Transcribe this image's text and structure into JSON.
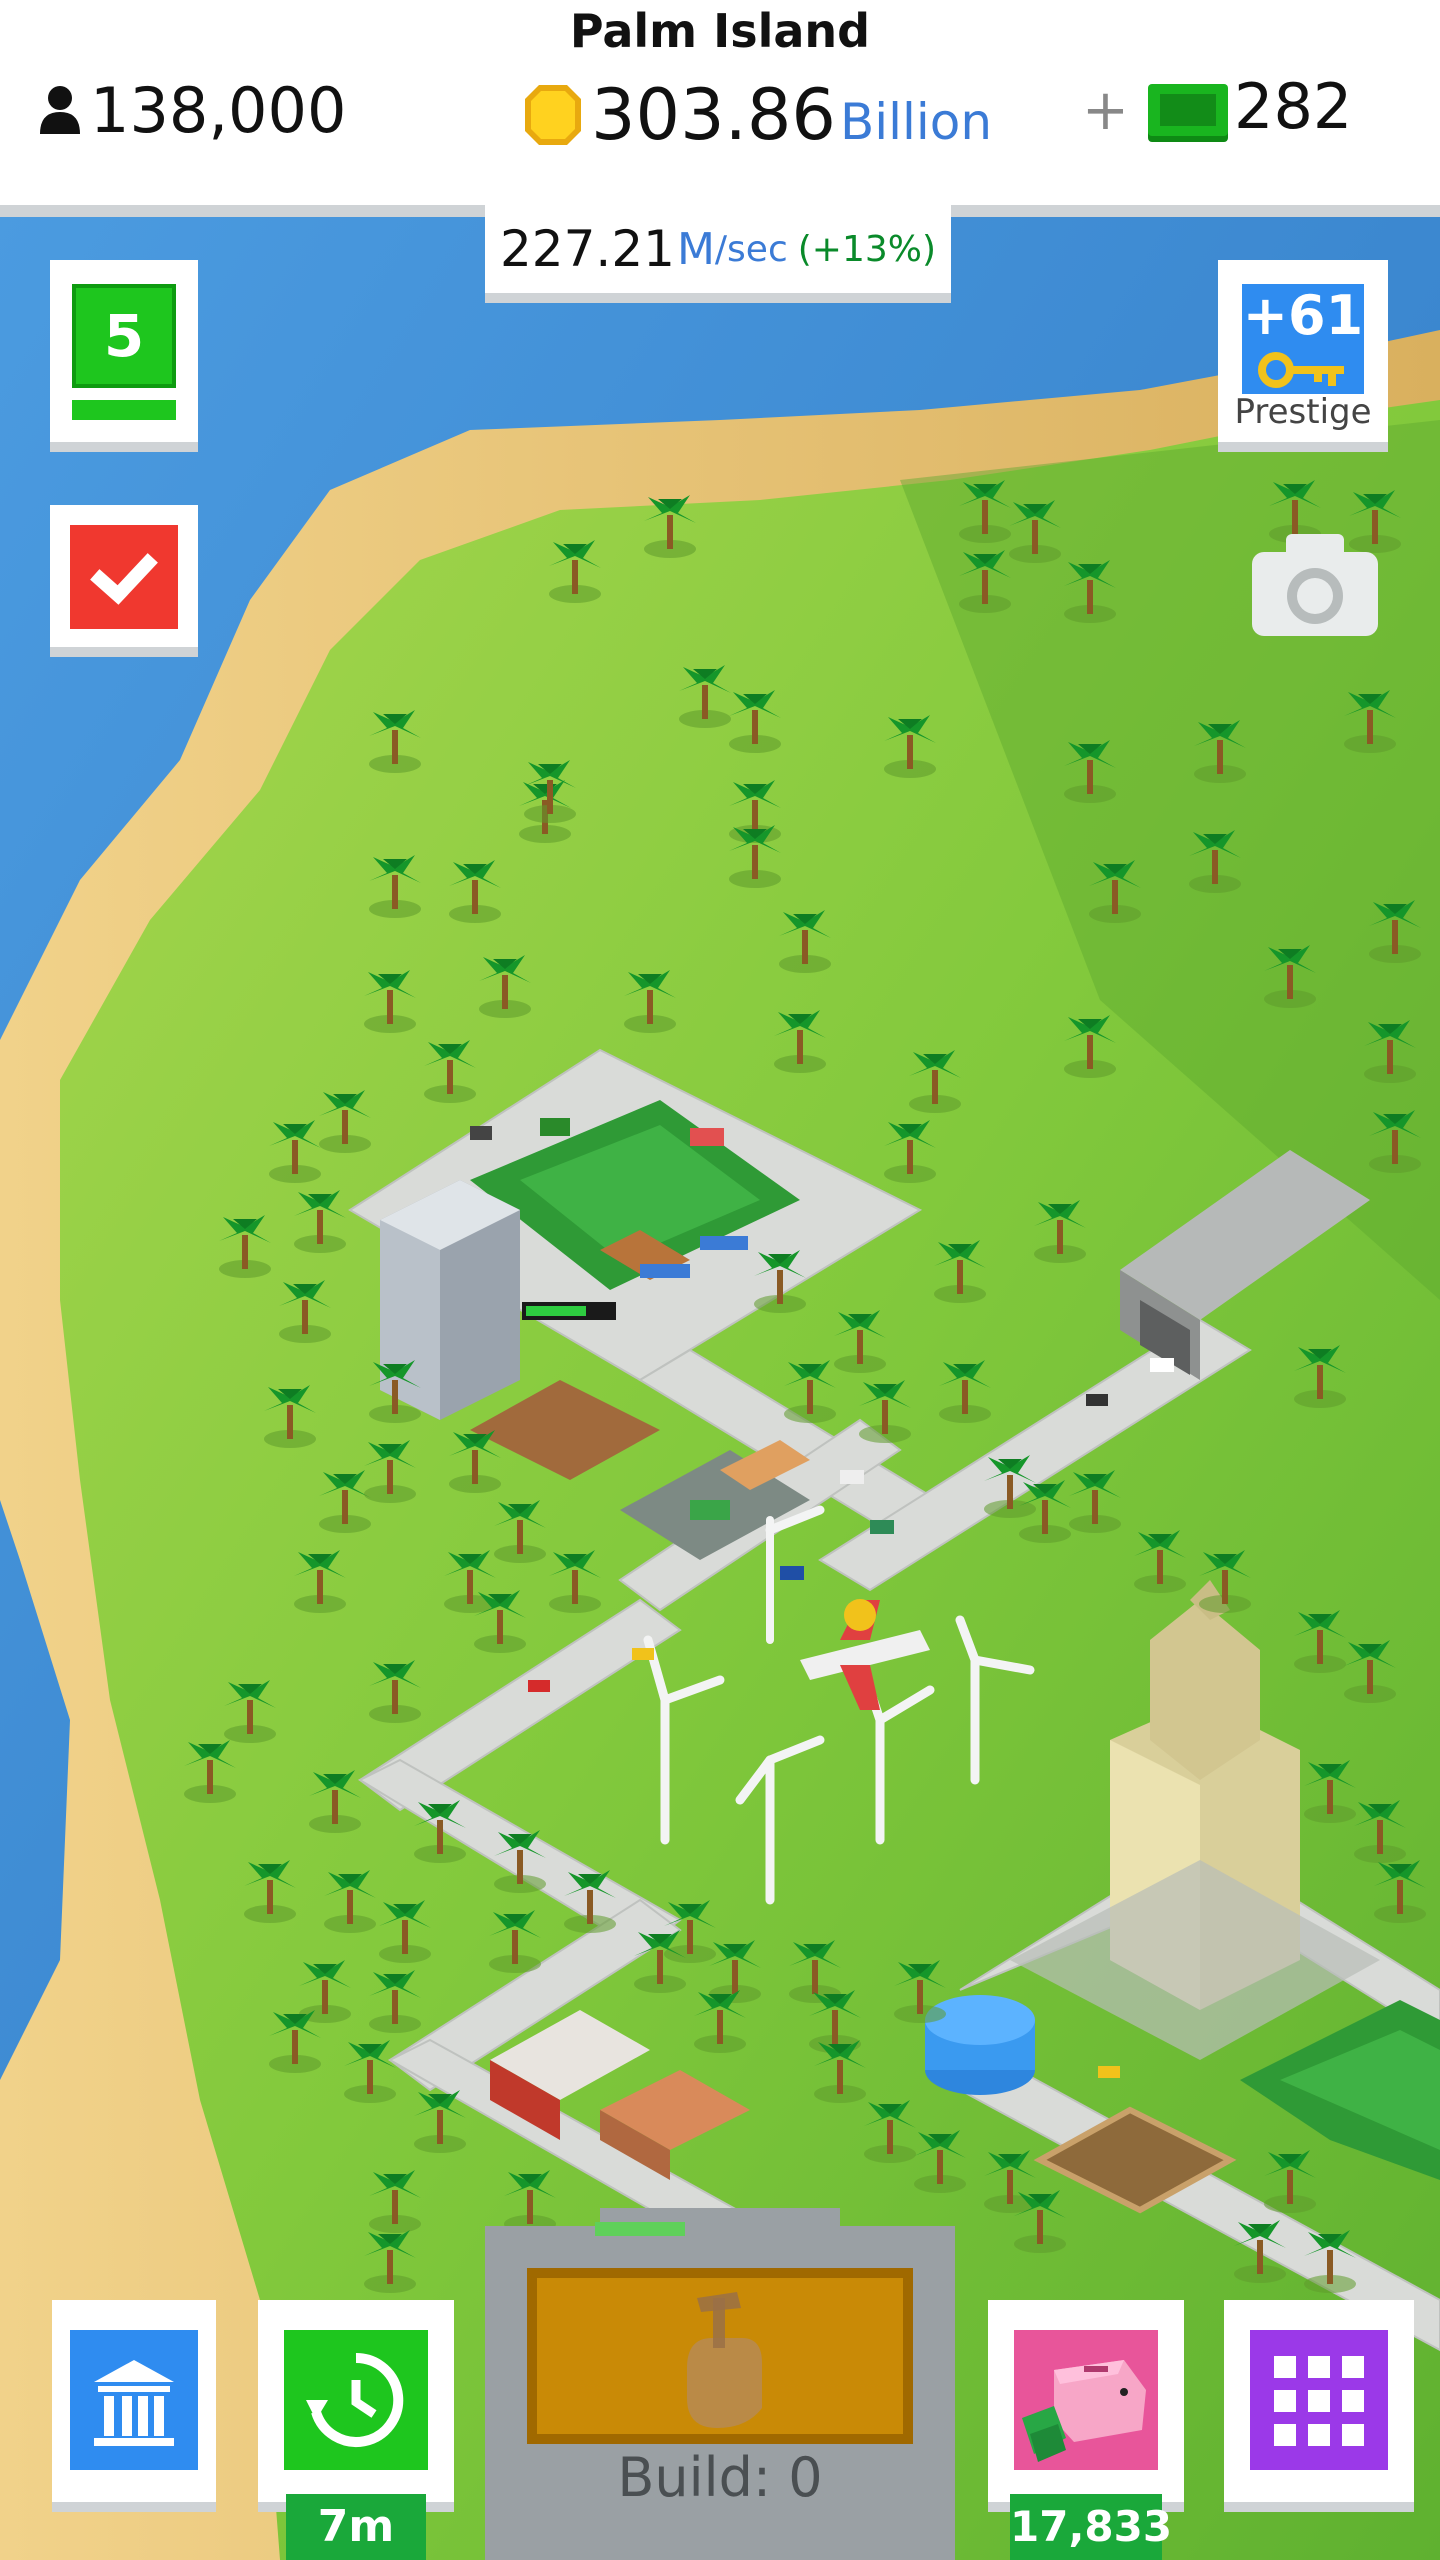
{
  "header": {
    "island_name": "Palm Island",
    "population": "138,000",
    "money_value": "303.86",
    "money_unit": "Billion",
    "add_cash_symbol": "+",
    "cash_value": "282"
  },
  "rate": {
    "value": "227.21",
    "unit": "M",
    "per": "/sec",
    "bonus": "(+13%)"
  },
  "left_controls": {
    "level": "5"
  },
  "prestige": {
    "keys": "+61",
    "label": "Prestige"
  },
  "bottom_bar": {
    "boost_timer": "7m",
    "build_label": "Build: 0",
    "piggy_value": "17,833"
  },
  "icons": {
    "population": "person-icon",
    "money": "coin-icon",
    "cash": "cash-note-icon",
    "tasks": "checkmark-icon",
    "prestige": "key-icon",
    "camera": "camera-icon",
    "bank": "bank-icon",
    "boost": "clock-refresh-icon",
    "build": "hammer-hand-icon",
    "piggy": "piggy-bank-icon",
    "menu": "grid-icon"
  },
  "colors": {
    "ocean": "#3d8ed6",
    "sand": "#e7c07a",
    "grass": "#7cc93a",
    "road": "#d9dbd8",
    "accent_blue": "#3b7bd6",
    "accent_green": "#1aa83a"
  }
}
